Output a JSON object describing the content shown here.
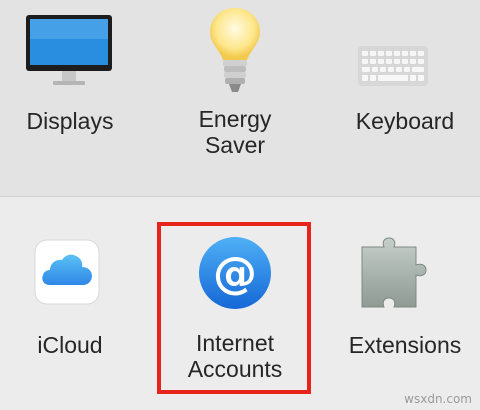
{
  "hardware_section": {
    "panes": [
      {
        "label": "Displays",
        "icon": "display-icon"
      },
      {
        "label": "Energy\nSaver",
        "icon": "light-bulb-icon"
      },
      {
        "label": "Keyboard",
        "icon": "keyboard-icon"
      }
    ]
  },
  "internet_section": {
    "panes": [
      {
        "label": "iCloud",
        "icon": "icloud-icon"
      },
      {
        "label": "Internet\nAccounts",
        "icon": "at-sign-icon"
      },
      {
        "label": "Extensions",
        "icon": "puzzle-piece-icon"
      }
    ]
  },
  "highlight_color": "#e8231b",
  "watermark": "wsxdn.com"
}
